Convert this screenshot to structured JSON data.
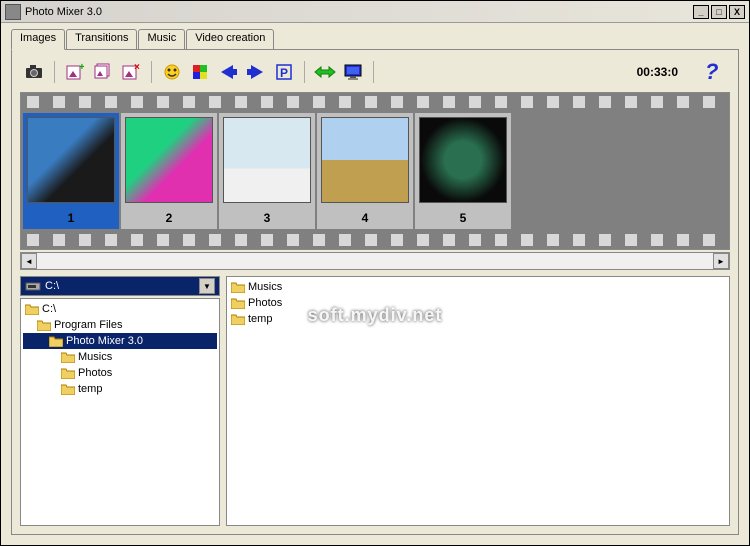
{
  "window": {
    "title": "Photo Mixer 3.0"
  },
  "tabs": [
    {
      "label": "Images"
    },
    {
      "label": "Transitions"
    },
    {
      "label": "Music"
    },
    {
      "label": "Video creation"
    }
  ],
  "time": "00:33:0",
  "frames": [
    {
      "num": "1"
    },
    {
      "num": "2"
    },
    {
      "num": "3"
    },
    {
      "num": "4"
    },
    {
      "num": "5"
    }
  ],
  "combo": {
    "value": "C:\\"
  },
  "tree": {
    "items": [
      {
        "label": "C:\\",
        "indent": 0
      },
      {
        "label": "Program Files",
        "indent": 1
      },
      {
        "label": "Photo Mixer 3.0",
        "indent": 2,
        "selected": true
      },
      {
        "label": "Musics",
        "indent": 3
      },
      {
        "label": "Photos",
        "indent": 3
      },
      {
        "label": "temp",
        "indent": 3
      }
    ]
  },
  "files": [
    {
      "name": "Musics"
    },
    {
      "name": "Photos"
    },
    {
      "name": "temp"
    }
  ],
  "watermark": "soft.mydiv.net"
}
